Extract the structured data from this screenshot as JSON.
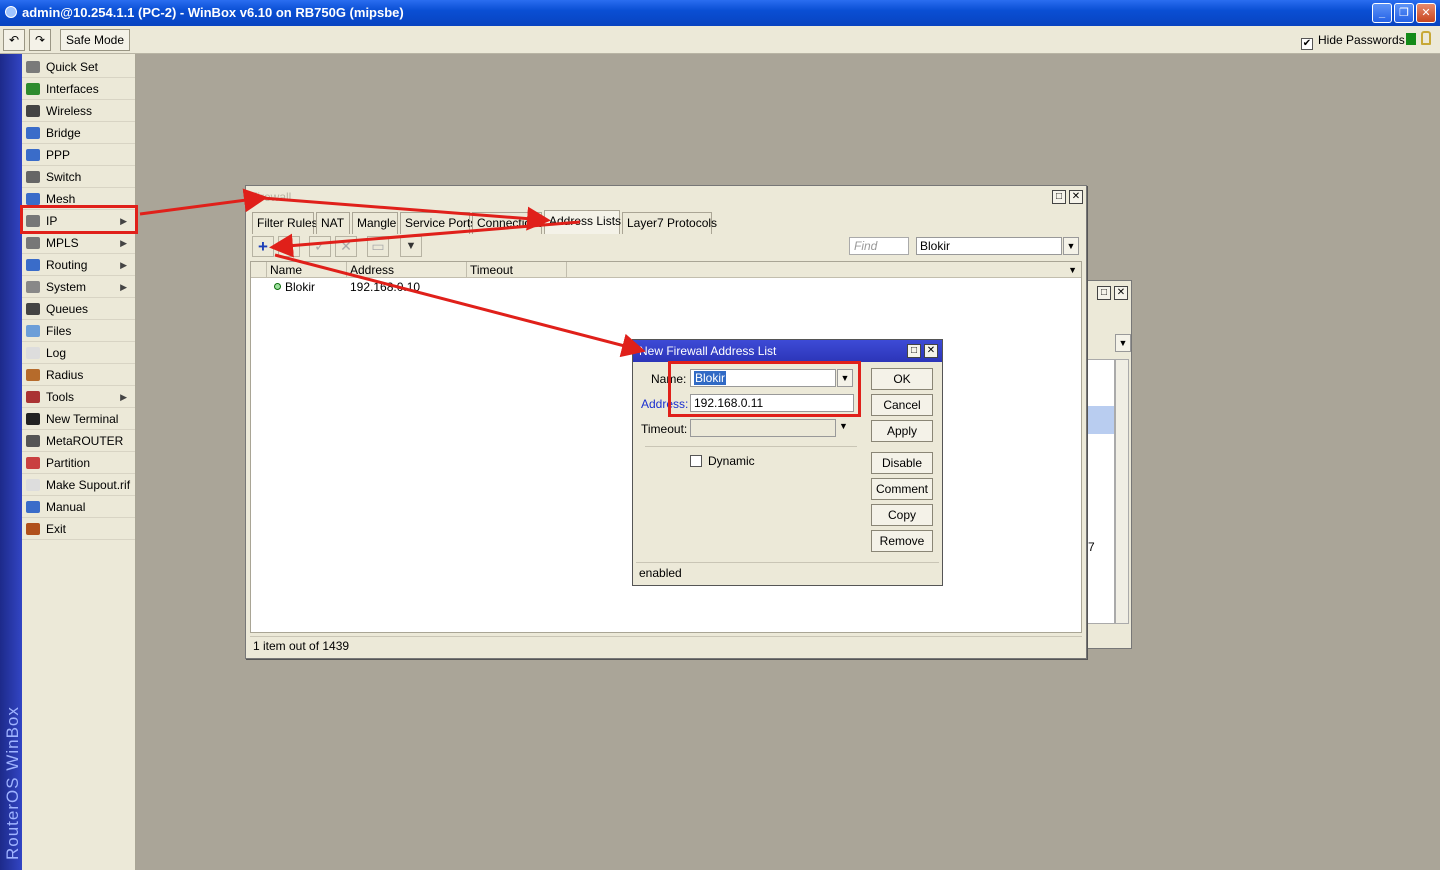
{
  "window": {
    "title": "admin@10.254.1.1 (PC-2) - WinBox v6.10 on RB750G (mipsbe)",
    "min_glyph": "_",
    "max_glyph": "❐",
    "close_glyph": "✕"
  },
  "toolbar": {
    "undo_glyph": "↶",
    "redo_glyph": "↷",
    "safe_mode_label": "Safe Mode",
    "hide_passwords_label": "Hide Passwords",
    "hide_passwords_check": "✔"
  },
  "brand": "RouterOS WinBox",
  "menu": [
    {
      "label": "Quick Set",
      "color": "#7a7a7a"
    },
    {
      "label": "Interfaces",
      "color": "#2e8b2e"
    },
    {
      "label": "Wireless",
      "color": "#444444"
    },
    {
      "label": "Bridge",
      "color": "#3a6cc9"
    },
    {
      "label": "PPP",
      "color": "#3a6cc9"
    },
    {
      "label": "Switch",
      "color": "#666666"
    },
    {
      "label": "Mesh",
      "color": "#3a6cc9"
    },
    {
      "label": "IP",
      "color": "#777777",
      "arrow": "▶"
    },
    {
      "label": "MPLS",
      "color": "#777777",
      "arrow": "▶"
    },
    {
      "label": "Routing",
      "color": "#3a6cc9",
      "arrow": "▶"
    },
    {
      "label": "System",
      "color": "#888888",
      "arrow": "▶"
    },
    {
      "label": "Queues",
      "color": "#444444"
    },
    {
      "label": "Files",
      "color": "#6c9ed8"
    },
    {
      "label": "Log",
      "color": "#dddddd"
    },
    {
      "label": "Radius",
      "color": "#b66b2b"
    },
    {
      "label": "Tools",
      "color": "#aa3333",
      "arrow": "▶"
    },
    {
      "label": "New Terminal",
      "color": "#222222"
    },
    {
      "label": "MetaROUTER",
      "color": "#555555"
    },
    {
      "label": "Partition",
      "color": "#c94040"
    },
    {
      "label": "Make Supout.rif",
      "color": "#dddddd"
    },
    {
      "label": "Manual",
      "color": "#3a6cc9"
    },
    {
      "label": "Exit",
      "color": "#b0501b"
    }
  ],
  "firewall": {
    "title": "Firewall",
    "tabs": [
      "Filter Rules",
      "NAT",
      "Mangle",
      "Service Ports",
      "Connections",
      "Address Lists",
      "Layer7 Protocols"
    ],
    "find_placeholder": "Find",
    "list_filter": "Blokir",
    "toolbar_glyphs": {
      "add": "+",
      "remove": "−",
      "enable": "✓",
      "disable": "✕",
      "comment": "▭",
      "filter": "▼"
    },
    "columns": [
      "Name",
      "Address",
      "Timeout"
    ],
    "rows": [
      {
        "name": "Blokir",
        "address": "192.168.0.10",
        "timeout": ""
      }
    ],
    "status": "1 item out of 1439"
  },
  "dialog": {
    "title": "New Firewall Address List",
    "name_label": "Name:",
    "name_value": "Blokir",
    "address_label": "Address:",
    "address_value": "192.168.0.11",
    "timeout_label": "Timeout:",
    "timeout_value": "",
    "dynamic_label": "Dynamic",
    "buttons": [
      "OK",
      "Cancel",
      "Apply",
      "Disable",
      "Comment",
      "Copy",
      "Remove"
    ],
    "status": "enabled"
  },
  "bg_window": {
    "partial_text": "7"
  },
  "colors": {
    "annotation_red": "#e0201a",
    "titlebar_blue": "#0a4fd4",
    "dialog_title_blue": "#2c35b8",
    "background": "#aaa598"
  }
}
